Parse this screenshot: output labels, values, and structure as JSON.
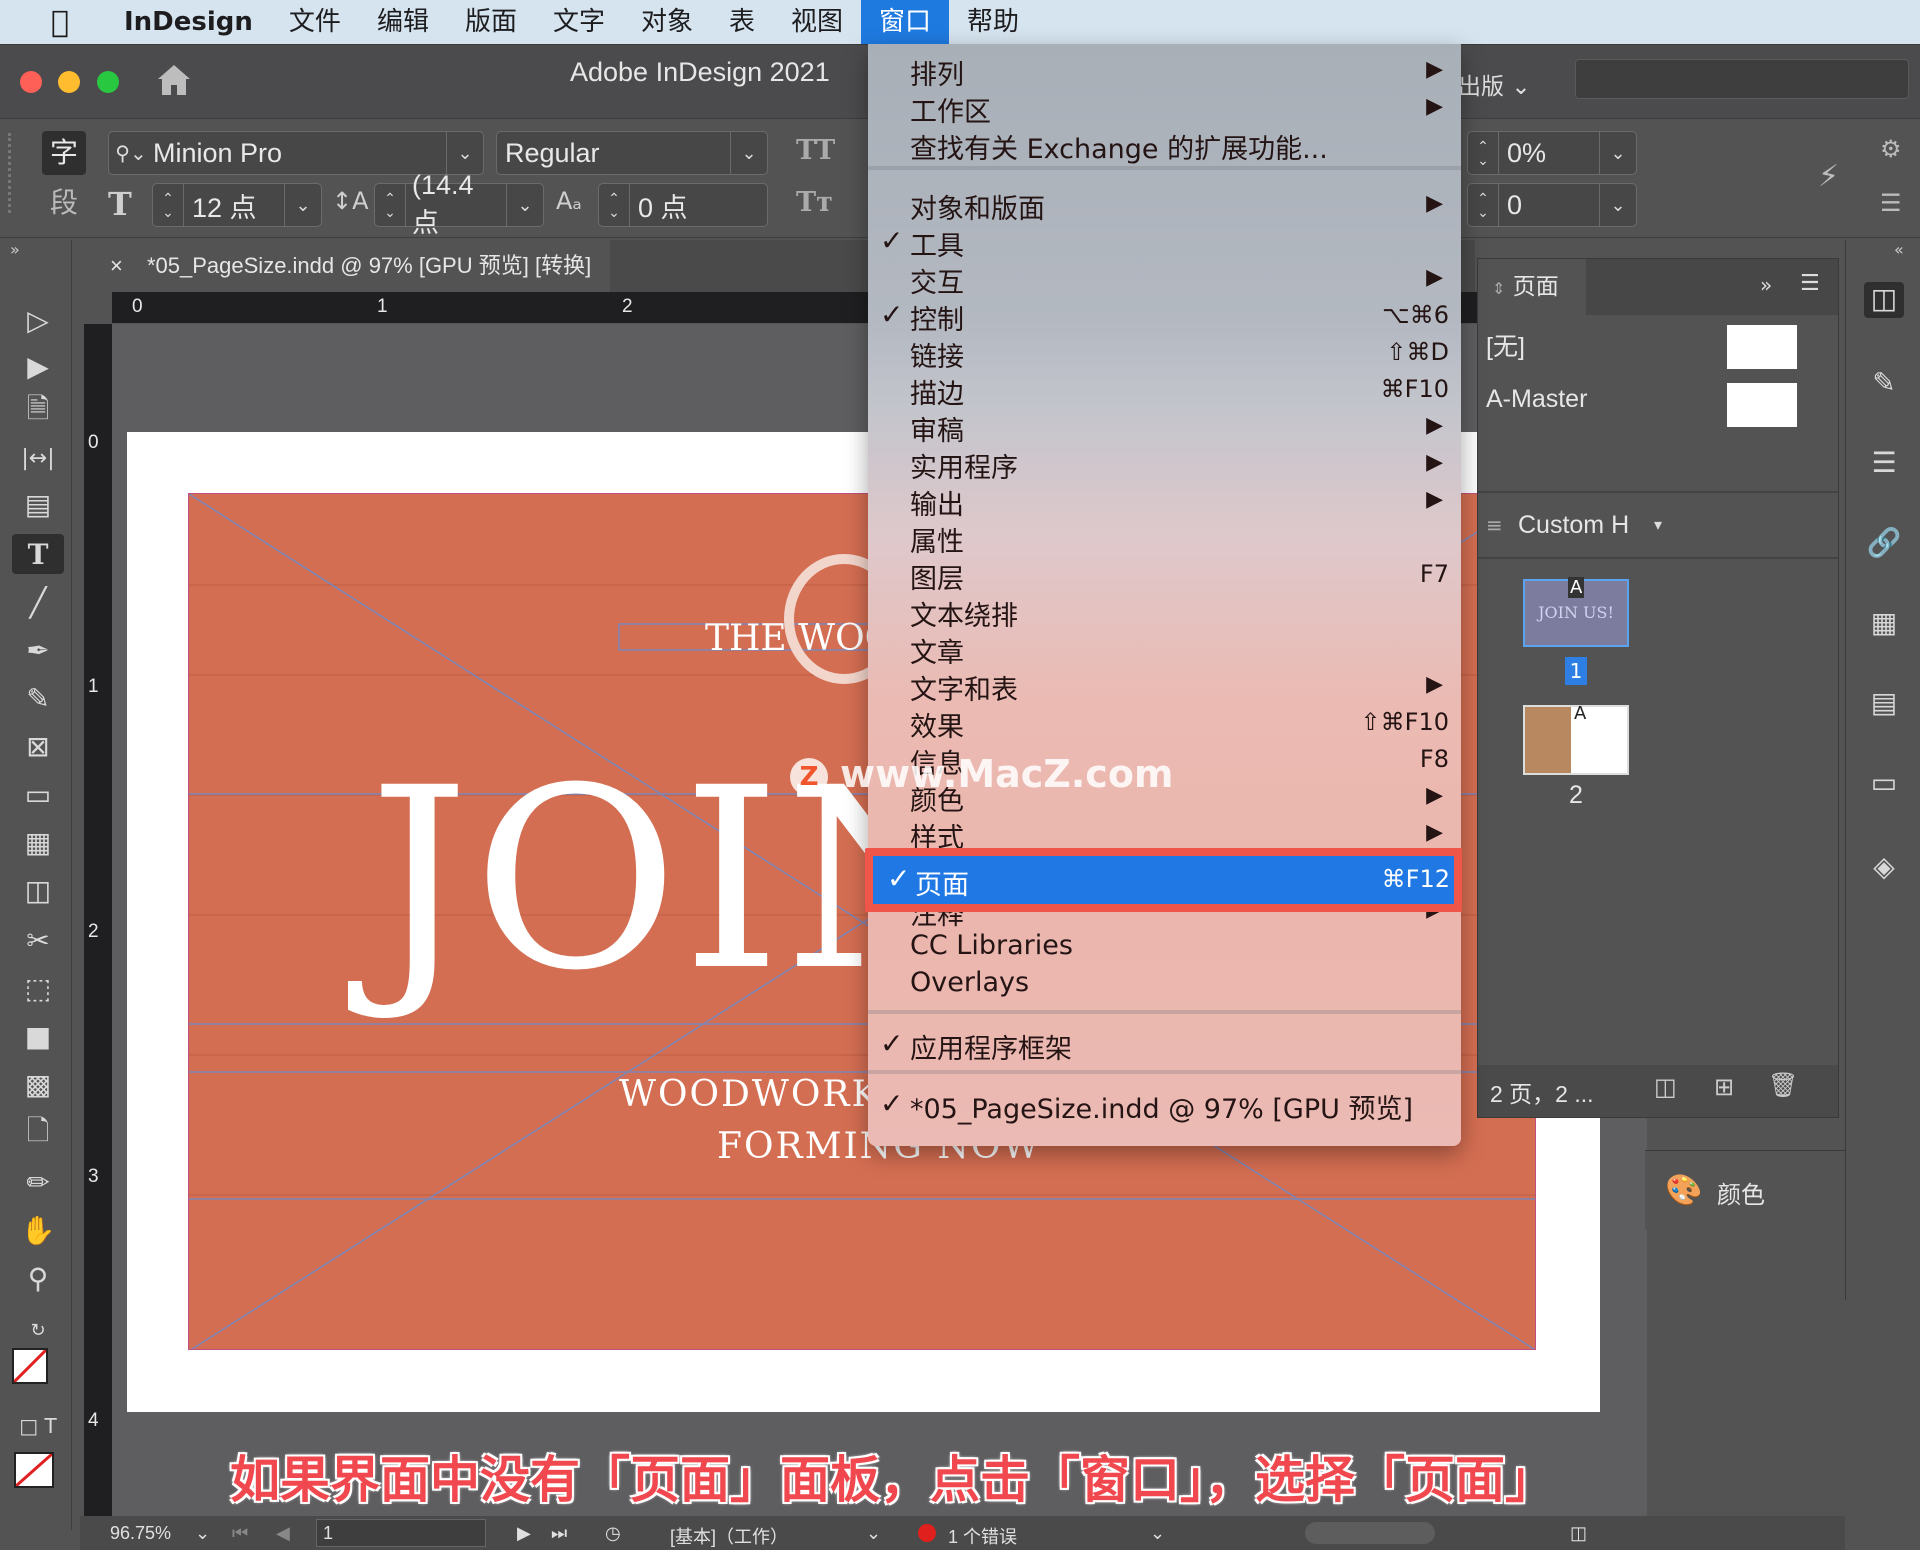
{
  "menubar": {
    "apple_icon": "apple-logo",
    "items": [
      "InDesign",
      "文件",
      "编辑",
      "版面",
      "文字",
      "对象",
      "表",
      "视图",
      "窗口",
      "帮助"
    ],
    "active_item": "窗口"
  },
  "window": {
    "title": "Adobe InDesign 2021",
    "workspace_label": "出版",
    "traffic_lights": {
      "close": "#fe5f57",
      "minimize": "#febc2e",
      "zoom": "#28c840"
    }
  },
  "control": {
    "char_tab": "字",
    "para_tab": "段",
    "font_family": "Minion Pro",
    "font_style": "Regular",
    "font_size": "12 点",
    "leading": "(14.4 点",
    "baseline_shift": "0 点",
    "tracking": "0%",
    "kerning": "0",
    "allcaps_label": "TT",
    "smallcaps_label": "Tт"
  },
  "document_tab": {
    "close_label": "×",
    "title": "*05_PageSize.indd @ 97% [GPU 预览] [转换]"
  },
  "rulers": {
    "horizontal": [
      "0",
      "1",
      "2"
    ],
    "vertical": [
      "0",
      "1",
      "2",
      "3",
      "4"
    ]
  },
  "artwork": {
    "tagline_top": "THE WOO",
    "headline": "JOIN",
    "sub1": "WOODWORK",
    "sub2": "FORMING NOW"
  },
  "window_menu": {
    "items": [
      {
        "label": "排列",
        "submenu": true
      },
      {
        "label": "工作区",
        "submenu": true
      },
      {
        "label": "查找有关 Exchange 的扩展功能..."
      },
      {
        "separator": true
      },
      {
        "label": "对象和版面",
        "submenu": true
      },
      {
        "label": "工具",
        "checked": true
      },
      {
        "label": "交互",
        "submenu": true
      },
      {
        "label": "控制",
        "checked": true,
        "shortcut": "⌥⌘6"
      },
      {
        "label": "链接",
        "shortcut": "⇧⌘D"
      },
      {
        "label": "描边",
        "shortcut": "⌘F10"
      },
      {
        "label": "审稿",
        "submenu": true
      },
      {
        "label": "实用程序",
        "submenu": true
      },
      {
        "label": "输出",
        "submenu": true
      },
      {
        "label": "属性"
      },
      {
        "label": "图层",
        "shortcut": "F7"
      },
      {
        "label": "文本绕排"
      },
      {
        "label": "文章"
      },
      {
        "label": "文字和表",
        "submenu": true
      },
      {
        "label": "效果",
        "shortcut": "⇧⌘F10"
      },
      {
        "label": "信息",
        "shortcut": "F8"
      },
      {
        "label": "颜色",
        "submenu": true
      },
      {
        "label": "样式",
        "submenu": true
      },
      {
        "label": "页面",
        "checked": true,
        "shortcut": "⌘F12",
        "highlighted": true
      },
      {
        "label": "注释",
        "submenu": true
      },
      {
        "label": "CC Libraries"
      },
      {
        "label": "Overlays"
      },
      {
        "separator": true
      },
      {
        "label": "应用程序框架",
        "checked": true
      },
      {
        "separator": true
      },
      {
        "label": "*05_PageSize.indd @ 97% [GPU 预览]",
        "checked": true
      }
    ],
    "check_glyph": "✓",
    "submenu_glyph": "▶",
    "highlight_color": "#1f78e3",
    "annotation_box_color": "#f0554a"
  },
  "pages_panel": {
    "tab_label": "页面",
    "masters": [
      "[无]",
      "A-Master"
    ],
    "page_size_label": "Custom H",
    "pages": [
      {
        "number": "1",
        "thumb_text": "JOIN US!",
        "master_prefix": "A",
        "selected": true
      },
      {
        "number": "2",
        "master_prefix": "A",
        "selected": false
      }
    ],
    "footer_text": "2 页，2 ..."
  },
  "color_panel": {
    "label": "颜色"
  },
  "statusbar": {
    "zoom": "96.75%",
    "page": "1",
    "profile": "[基本]（工作）",
    "errors": "1 个错误",
    "error_color": "#e0201c"
  },
  "watermark": "www.MacZ.com",
  "caption": "如果界面中没有「页面」面板，点击「窗口」，选择「页面」"
}
